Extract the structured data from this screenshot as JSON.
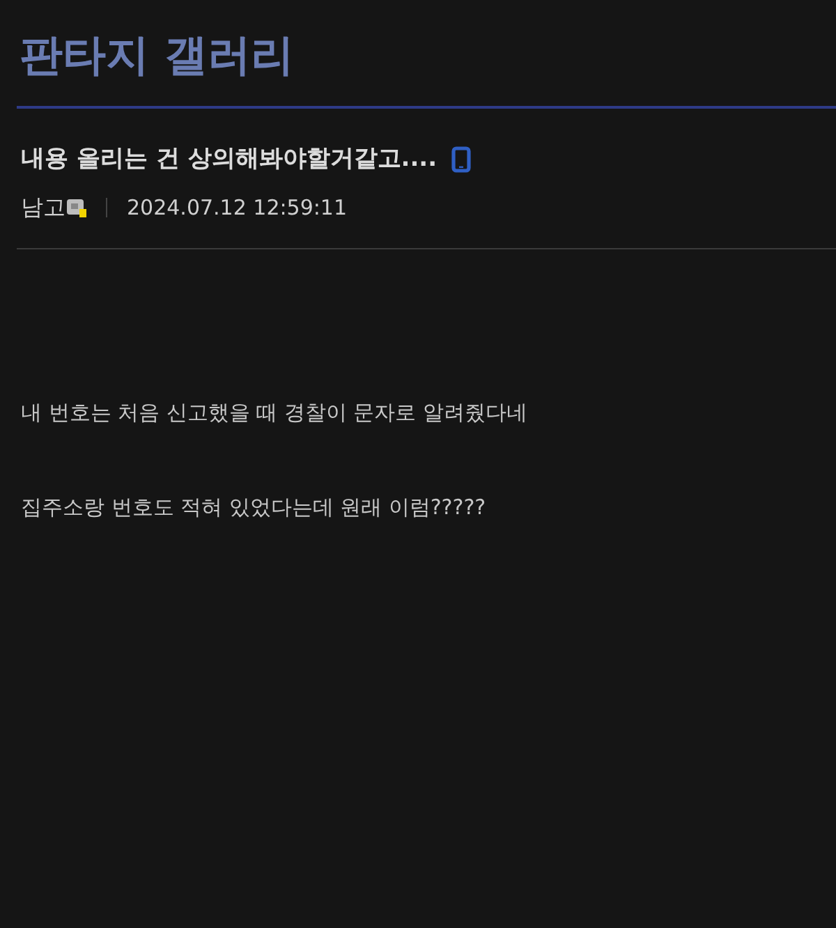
{
  "gallery": {
    "title": "판타지 갤러리"
  },
  "post": {
    "title": "내용 올리는 건 상의해봐야할거같고....",
    "mobile": true,
    "author": "남고",
    "date": "2024.07.12 12:59:11",
    "paragraphs": [
      "내 번호는 처음 신고했을 때 경찰이 문자로 알려줬다네",
      "집주소랑 번호도 적혀 있었다는데 원래 이럼?????"
    ]
  }
}
